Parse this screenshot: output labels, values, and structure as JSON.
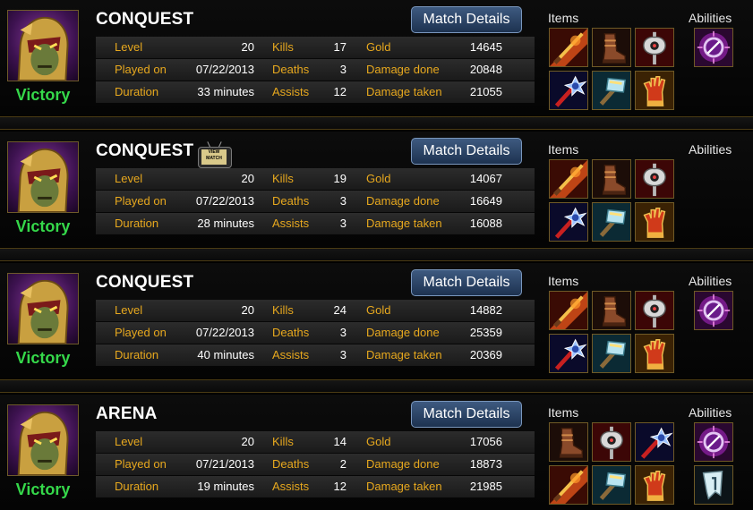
{
  "labels": {
    "level": "Level",
    "played_on": "Played on",
    "duration": "Duration",
    "kills": "Kills",
    "deaths": "Deaths",
    "assists": "Assists",
    "gold": "Gold",
    "damage_done": "Damage done",
    "damage_taken": "Damage taken",
    "items": "Items",
    "abilities": "Abilities",
    "match_details": "Match Details",
    "view_match_line1": "VIEW",
    "view_match_line2": "MATCH"
  },
  "colors": {
    "victory": "#35d84a",
    "label": "#e7a81e",
    "button": "#2c4468",
    "divider": "#4c3c14"
  },
  "matches": [
    {
      "mode": "CONQUEST",
      "result": "Victory",
      "has_replay": false,
      "level": "20",
      "played_on": "07/22/2013",
      "duration": "33 minutes",
      "kills": "17",
      "deaths": "3",
      "assists": "12",
      "gold": "14645",
      "damage_done": "20848",
      "damage_taken": "21055",
      "items": [
        "flaming-sword-icon",
        "boots-icon",
        "battle-axe-icon",
        "mace-icon",
        "hammer-icon",
        "gauntlet-icon"
      ],
      "abilities": [
        "purification-icon"
      ]
    },
    {
      "mode": "CONQUEST",
      "result": "Victory",
      "has_replay": true,
      "level": "20",
      "played_on": "07/22/2013",
      "duration": "28 minutes",
      "kills": "19",
      "deaths": "3",
      "assists": "3",
      "gold": "14067",
      "damage_done": "16649",
      "damage_taken": "16088",
      "items": [
        "flaming-sword-icon",
        "boots-icon",
        "battle-axe-icon",
        "mace-icon",
        "hammer-icon",
        "gauntlet-icon"
      ],
      "abilities": []
    },
    {
      "mode": "CONQUEST",
      "result": "Victory",
      "has_replay": false,
      "level": "20",
      "played_on": "07/22/2013",
      "duration": "40 minutes",
      "kills": "24",
      "deaths": "3",
      "assists": "3",
      "gold": "14882",
      "damage_done": "25359",
      "damage_taken": "20369",
      "items": [
        "flaming-sword-icon",
        "boots-icon",
        "battle-axe-icon",
        "mace-icon",
        "hammer-icon",
        "gauntlet-icon"
      ],
      "abilities": [
        "purification-icon"
      ]
    },
    {
      "mode": "ARENA",
      "result": "Victory",
      "has_replay": false,
      "level": "20",
      "played_on": "07/21/2013",
      "duration": "19 minutes",
      "kills": "14",
      "deaths": "2",
      "assists": "12",
      "gold": "17056",
      "damage_done": "18873",
      "damage_taken": "21985",
      "items": [
        "boots-icon",
        "battle-axe-icon",
        "mace-icon",
        "flaming-sword-icon",
        "hammer-icon",
        "gauntlet-icon"
      ],
      "abilities": [
        "purification-icon",
        "sprint-banner-icon"
      ]
    }
  ]
}
